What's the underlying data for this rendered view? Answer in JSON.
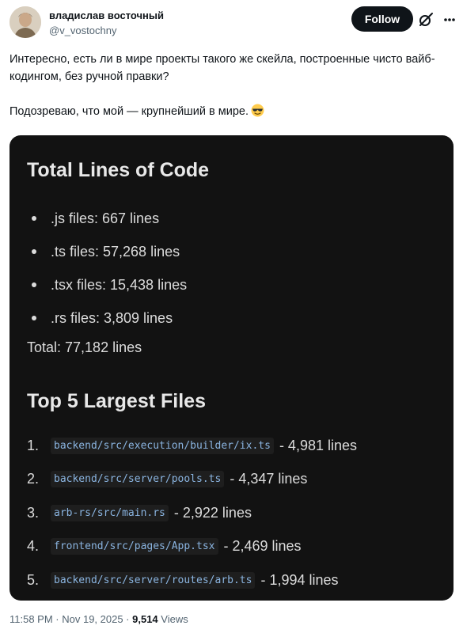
{
  "author": {
    "name": "владислав восточный",
    "handle": "@v_vostochny"
  },
  "header": {
    "follow_label": "Follow"
  },
  "icons": {
    "avatar": "avatar-icon",
    "grok": "grok-icon",
    "more": "more-icon",
    "emoji": "sunglasses-emoji-icon"
  },
  "tweet": {
    "paragraph1": "Интересно, есть ли в мире проекты такого же скейла, построенные чисто вайб-кодингом, без ручной правки?",
    "paragraph2": "Подозреваю, что мой — крупнейший в мире."
  },
  "media": {
    "total_heading": "Total Lines of Code",
    "file_types": [
      {
        "text": ".js files: 667 lines"
      },
      {
        "text": ".ts files: 57,268 lines"
      },
      {
        "text": ".tsx files: 15,438 lines"
      },
      {
        "text": ".rs files: 3,809 lines"
      }
    ],
    "total": "Total: 77,182 lines",
    "largest_heading": "Top 5 Largest Files",
    "largest_files": [
      {
        "num": "1.",
        "path": "backend/src/execution/builder/ix.ts",
        "lines": "- 4,981 lines"
      },
      {
        "num": "2.",
        "path": "backend/src/server/pools.ts",
        "lines": "- 4,347 lines"
      },
      {
        "num": "3.",
        "path": "arb-rs/src/main.rs",
        "lines": "- 2,922 lines"
      },
      {
        "num": "4.",
        "path": "frontend/src/pages/App.tsx",
        "lines": "- 2,469 lines"
      },
      {
        "num": "5.",
        "path": "backend/src/server/routes/arb.ts",
        "lines": "- 1,994 lines"
      }
    ]
  },
  "footer": {
    "timestamp": "11:58 PM · Nov 19, 2025 · ",
    "views_count": "9,514",
    "views_label": " Views"
  },
  "colors": {
    "follow_bg": "#0f1419",
    "media_bg": "#121212",
    "code_text": "#8ab4e0",
    "secondary_text": "#536471"
  }
}
